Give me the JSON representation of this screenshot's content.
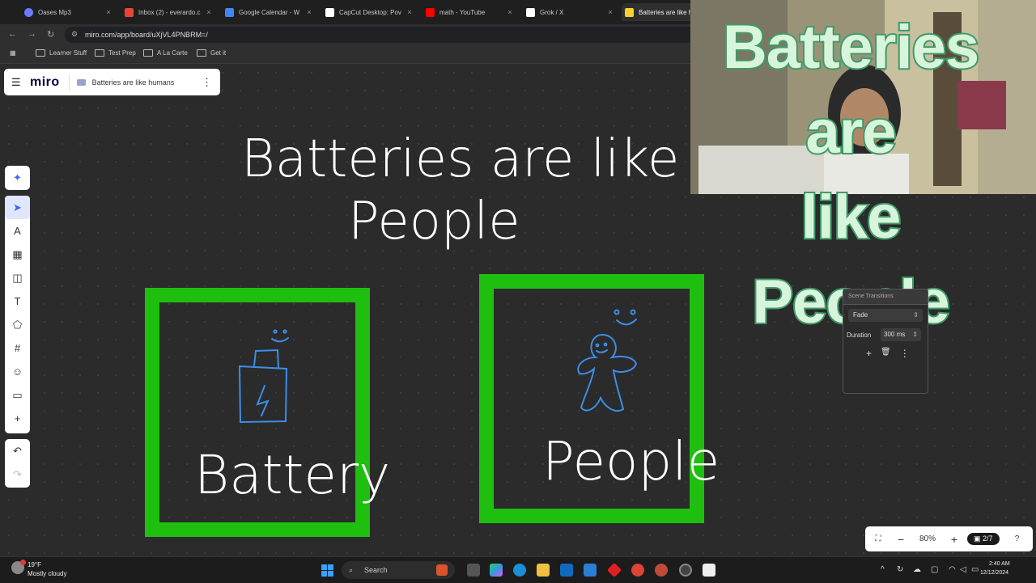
{
  "browser": {
    "tabs": [
      {
        "label": "Oases Mp3",
        "color": "#6b7bff"
      },
      {
        "label": "Inbox (2) - everardo.c",
        "color": "#ea4335"
      },
      {
        "label": "Google Calendar - W",
        "color": "#4285f4"
      },
      {
        "label": "CapCut Desktop: Pov",
        "color": "#ffffff"
      },
      {
        "label": "math - YouTube",
        "color": "#ff0000"
      },
      {
        "label": "Grok / X",
        "color": "#ffffff"
      },
      {
        "label": "Batteries are like h",
        "color": "#ffd02f"
      }
    ],
    "close_glyph": "×",
    "nav": {
      "back": "←",
      "forward": "→",
      "reload": "↻"
    },
    "url": "miro.com/app/board/uXjVL4PNBRM=/",
    "bookmarks": [
      "Learner Stuff",
      "Test Prep",
      "A La Carte",
      "Get it"
    ]
  },
  "miro": {
    "logo": "miro",
    "board_name": "Batteries are like humans",
    "menu_glyph": "☰",
    "more_glyph": "⋮",
    "ai_tool_glyph": "✦",
    "tools": [
      {
        "name": "select-tool",
        "glyph": "➤"
      },
      {
        "name": "pen-tool",
        "glyph": "A"
      },
      {
        "name": "templates-tool",
        "glyph": "▦"
      },
      {
        "name": "sticky-note-tool",
        "glyph": "◫"
      },
      {
        "name": "text-tool",
        "glyph": "T"
      },
      {
        "name": "shapes-tool",
        "glyph": "⬠"
      },
      {
        "name": "frame-tool",
        "glyph": "#"
      },
      {
        "name": "stickers-tool",
        "glyph": "☺"
      },
      {
        "name": "comment-tool",
        "glyph": "▭"
      },
      {
        "name": "more-tools",
        "glyph": "+"
      }
    ],
    "undo_glyph": "↶",
    "redo_glyph": "↷",
    "board": {
      "title_line1": "Batteries are like",
      "title_line2": "People",
      "frame1_label": "Battery",
      "frame2_label": "People",
      "frame_color": "#1fbf10",
      "ink_white": "#ffffff",
      "ink_blue": "#3c8ee6"
    },
    "zoom": {
      "fit_glyph": "⛶",
      "minus": "−",
      "value": "80%",
      "plus": "+",
      "page": "2/7",
      "help": "?"
    }
  },
  "overlay": {
    "lines": [
      "Batteries",
      "are",
      "like People"
    ],
    "fill": "#d8f5dc",
    "stroke": "#3f9b69"
  },
  "scene_panel": {
    "title": "Scene Transitions",
    "transition": "Fade",
    "duration_label": "Duration",
    "duration": "300 ms",
    "add": "+",
    "delete": "🗑",
    "more": "⋮"
  },
  "taskbar": {
    "weather_temp": "19°F",
    "weather_desc": "Mostly cloudy",
    "search": "Search",
    "time": "2:40 AM",
    "date": "12/12/2024",
    "tray_up": "^"
  }
}
